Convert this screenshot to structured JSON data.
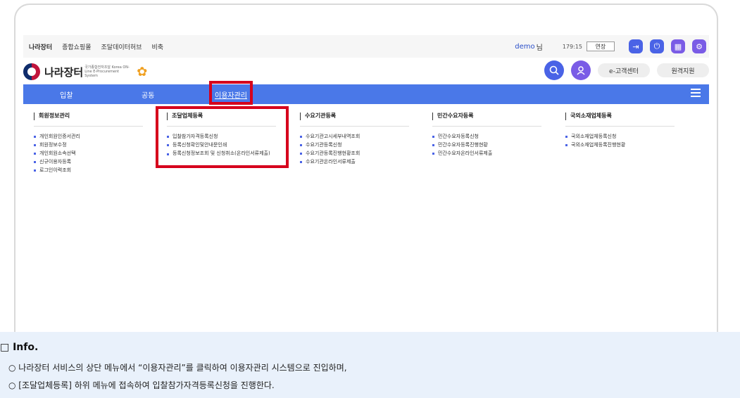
{
  "topbar": {
    "links": [
      "나라장터",
      "종합쇼핑몰",
      "조달데이터허브",
      "비축"
    ],
    "user": "demo",
    "user_suffix": "님",
    "timer": "179:15",
    "extend_label": "연장",
    "icons": [
      "logout-icon",
      "power-icon",
      "grid-icon",
      "settings-icon"
    ]
  },
  "header": {
    "logo_text": "나라장터",
    "logo_sub": "국가종합전자조달 Korea ON-Line E-Procurement System",
    "customer_center": "e-고객센터",
    "remote_support": "원격지원"
  },
  "nav": {
    "items": [
      "입찰",
      "공동",
      "이용자관리"
    ],
    "active": "이용자관리"
  },
  "menu": {
    "columns": [
      {
        "title": "회원정보관리",
        "items": [
          "개인회원인증서관리",
          "회원정보수정",
          "개인회원소속선택",
          "신규이용자등록",
          "로그인이력조회"
        ]
      },
      {
        "title": "조달업체등록",
        "items": [
          "입찰참가자격등록신청",
          "등록신청확인및안내문인쇄",
          "등록신청정보조회 및 신청취소(온라인서류제출)"
        ]
      },
      {
        "title": "수요기관등록",
        "items": [
          "수요기관고시세부내역조회",
          "수요기관등록신청",
          "수요기관등록진행현황조회",
          "수요기관온라인서류제출"
        ]
      },
      {
        "title": "민간수요자등록",
        "items": [
          "민간수요자등록신청",
          "민간수요자등록진행현황",
          "민간수요자온라인서류제출"
        ]
      },
      {
        "title": "국외소재업체등록",
        "items": [
          "국외소재업체등록신청",
          "국외소재업체등록진행현황"
        ]
      }
    ]
  },
  "info": {
    "title": "□ Info.",
    "lines": [
      "○ 나라장터 서비스의 상단 메뉴에서 “이용자관리”를 클릭하여 이용자관리 시스템으로 진입하며,",
      "○ [조달업체등록] 하위 메뉴에 접속하여 입찰참가자격등록신청을 진행한다."
    ]
  },
  "colors": {
    "nav": "#4a78e8",
    "highlight": "#d6001c",
    "info_bg": "#e9f1fb"
  }
}
